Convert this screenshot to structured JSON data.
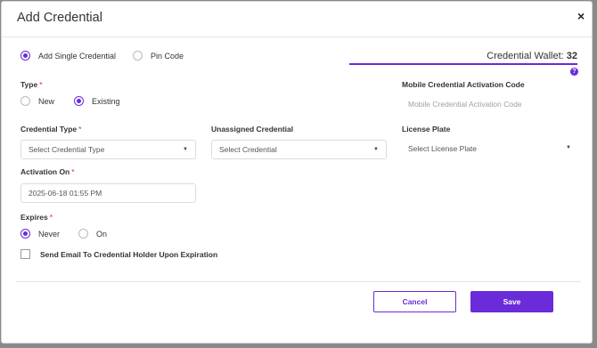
{
  "dialog": {
    "title": "Add Credential",
    "close_glyph": "×"
  },
  "mode": {
    "options": [
      {
        "label": "Add Single Credential",
        "checked": true
      },
      {
        "label": "Pin Code",
        "checked": false
      }
    ]
  },
  "wallet": {
    "label": "Credential Wallet:",
    "count": "32",
    "help_glyph": "?"
  },
  "type": {
    "label": "Type",
    "required_mark": "*",
    "options": [
      {
        "label": "New",
        "checked": false
      },
      {
        "label": "Existing",
        "checked": true
      }
    ]
  },
  "mobile_activation": {
    "label": "Mobile Credential Activation Code",
    "placeholder": "Mobile Credential Activation Code"
  },
  "credential_type": {
    "label": "Credential Type",
    "required_mark": "*",
    "value": "Select Credential Type"
  },
  "unassigned_credential": {
    "label": "Unassigned Credential",
    "value": "Select Credential"
  },
  "license_plate": {
    "label": "License Plate",
    "value": "Select License Plate"
  },
  "activation_on": {
    "label": "Activation On",
    "required_mark": "*",
    "value": "2025-06-18 01:55 PM"
  },
  "expires": {
    "label": "Expires",
    "required_mark": "*",
    "options": [
      {
        "label": "Never",
        "checked": true
      },
      {
        "label": "On",
        "checked": false
      }
    ]
  },
  "send_email": {
    "label": "Send Email To Credential Holder Upon Expiration",
    "checked": false
  },
  "buttons": {
    "cancel": "Cancel",
    "save": "Save"
  },
  "caret_glyph": "▼",
  "colors": {
    "accent": "#6a2bd9",
    "required": "#e0213d"
  }
}
